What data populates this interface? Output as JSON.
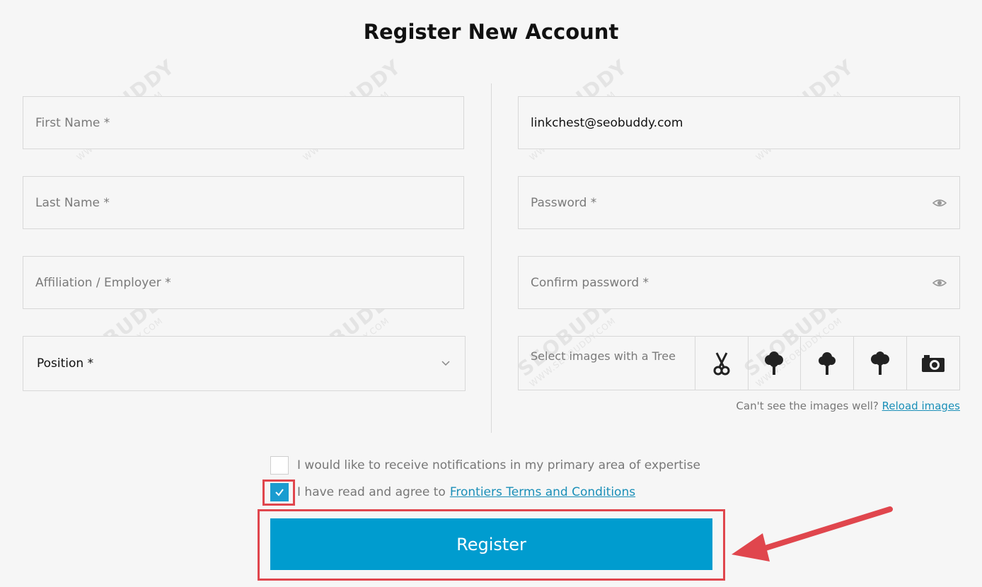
{
  "page": {
    "title": "Register New Account"
  },
  "form": {
    "first_name_placeholder": "First Name *",
    "last_name_placeholder": "Last Name *",
    "affiliation_placeholder": "Affiliation / Employer *",
    "position_label": "Position *",
    "email_value": "linkchest@seobuddy.com",
    "password_placeholder": "Password *",
    "confirm_password_placeholder": "Confirm password *"
  },
  "captcha": {
    "label": "Select images with a Tree",
    "icons": [
      "scissors-icon",
      "tree-icon",
      "tree-icon",
      "tree-icon",
      "camera-icon"
    ],
    "help_text": "Can't see the images well?",
    "reload_link": "Reload images"
  },
  "checkboxes": {
    "notifications_label": "I would like to receive notifications in my primary area of expertise",
    "notifications_checked": false,
    "terms_prefix": "I have read and agree to",
    "terms_link": "Frontiers Terms and Conditions",
    "terms_checked": true
  },
  "register_button": "Register",
  "watermark": {
    "brand": "SEOBUDDY",
    "url": "WWW.SEOBUDDY.COM"
  },
  "colors": {
    "accent": "#009ccf",
    "highlight": "#e0464d",
    "link": "#1a8fb8"
  }
}
